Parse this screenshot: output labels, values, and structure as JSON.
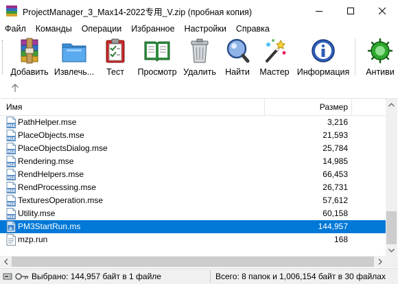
{
  "window": {
    "title": "ProjectManager_3_Max14-2022专用_V.zip (пробная копия)"
  },
  "menu": [
    "Файл",
    "Команды",
    "Операции",
    "Избранное",
    "Настройки",
    "Справка"
  ],
  "toolbar": {
    "buttons": [
      {
        "label": "Добавить",
        "icon": "winrar-add-icon"
      },
      {
        "label": "Извлечь...",
        "icon": "extract-folder-icon"
      },
      {
        "label": "Тест",
        "icon": "test-clipboard-icon"
      },
      {
        "label": "Просмотр",
        "icon": "view-book-icon"
      },
      {
        "label": "Удалить",
        "icon": "trash-can-icon"
      },
      {
        "label": "Найти",
        "icon": "magnifier-icon"
      },
      {
        "label": "Мастер",
        "icon": "magic-wand-icon"
      },
      {
        "label": "Информация",
        "icon": "info-icon"
      },
      {
        "label": "Антиви",
        "icon": "antivirus-icon"
      }
    ]
  },
  "filelist": {
    "columns": {
      "name": "Имя",
      "size": "Размер"
    },
    "rows": [
      {
        "name": "PathHelper.mse",
        "size": "3,216",
        "icon": "mse-file-icon"
      },
      {
        "name": "PlaceObjects.mse",
        "size": "21,593",
        "icon": "mse-file-icon"
      },
      {
        "name": "PlaceObjectsDialog.mse",
        "size": "25,784",
        "icon": "mse-file-icon"
      },
      {
        "name": "Rendering.mse",
        "size": "14,985",
        "icon": "mse-file-icon"
      },
      {
        "name": "RendHelpers.mse",
        "size": "66,453",
        "icon": "mse-file-icon"
      },
      {
        "name": "RendProcessing.mse",
        "size": "26,731",
        "icon": "mse-file-icon"
      },
      {
        "name": "TexturesOperation.mse",
        "size": "57,612",
        "icon": "mse-file-icon"
      },
      {
        "name": "Utility.mse",
        "size": "60,158",
        "icon": "mse-file-icon"
      },
      {
        "name": "PM3StartRun.ms",
        "size": "144,957",
        "icon": "ms-file-icon",
        "selected": true
      },
      {
        "name": "mzp.run",
        "size": "168",
        "icon": "run-file-icon"
      }
    ]
  },
  "status": {
    "left": "Выбрано: 144,957 байт в 1 файле",
    "right": "Всего: 8 папок и 1,006,154 байт в 30 файлах"
  },
  "colors": {
    "selection": "#0078d7",
    "scrollbar_track": "#f0f0f0",
    "scrollbar_thumb": "#cdcdcd"
  }
}
